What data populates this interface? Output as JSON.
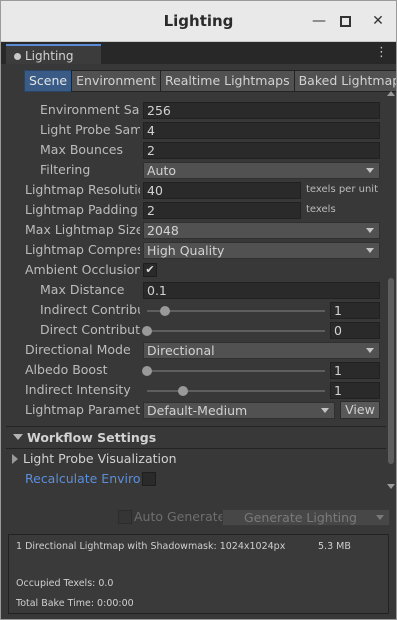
{
  "window": {
    "title": "Lighting"
  },
  "titlebar_buttons": {
    "minimize": "—",
    "maximize": "□",
    "close": "✕"
  },
  "tab": {
    "label": "Lighting"
  },
  "subtabs": [
    "Scene",
    "Environment",
    "Realtime Lightmaps",
    "Baked Lightmaps"
  ],
  "settings": {
    "environment_samples": {
      "label": "Environment Sam",
      "value": "256"
    },
    "light_probe_samples": {
      "label": "Light Probe Samp",
      "value": "4"
    },
    "max_bounces": {
      "label": "Max Bounces",
      "value": "2"
    },
    "filtering": {
      "label": "Filtering",
      "value": "Auto"
    },
    "lightmap_resolution": {
      "label": "Lightmap Resolution",
      "value": "40",
      "unit": "texels per unit"
    },
    "lightmap_padding": {
      "label": "Lightmap Padding",
      "value": "2",
      "unit": "texels"
    },
    "max_lightmap_size": {
      "label": "Max Lightmap Size",
      "value": "2048"
    },
    "lightmap_compression": {
      "label": "Lightmap Compressi",
      "value": "High Quality"
    },
    "ambient_occlusion": {
      "label": "Ambient Occlusion",
      "checked": true,
      "check_glyph": "✔"
    },
    "max_distance": {
      "label": "Max Distance",
      "value": "0.1"
    },
    "indirect_contribution": {
      "label": "Indirect Contributi",
      "value": "1",
      "slider_fraction": 0.1
    },
    "direct_contribution": {
      "label": "Direct Contributio",
      "value": "0",
      "slider_fraction": 0.0
    },
    "directional_mode": {
      "label": "Directional Mode",
      "value": "Directional"
    },
    "albedo_boost": {
      "label": "Albedo Boost",
      "value": "1",
      "slider_fraction": 0.0
    },
    "indirect_intensity": {
      "label": "Indirect Intensity",
      "value": "1",
      "slider_fraction": 0.2
    },
    "lightmap_parameters": {
      "label": "Lightmap Parameter",
      "value": "Default-Medium",
      "button": "View"
    }
  },
  "sections": {
    "workflow": "Workflow Settings",
    "light_probe_visualization": "Light Probe Visualization",
    "recalculate": "Recalculate Environi"
  },
  "generate": {
    "auto_label": "Auto Generate",
    "button": "Generate Lighting"
  },
  "info": {
    "lightmap_line": "1 Directional Lightmap with Shadowmask: 1024x1024px",
    "size": "5.3 MB",
    "occupied": "Occupied Texels: 0.0",
    "bake_time": "Total Bake Time: 0:00:00"
  },
  "colors": {
    "accent": "#3a5b85",
    "tab_highlight": "#5a8ad4",
    "link": "#5d8ed9",
    "panel": "#383838"
  }
}
